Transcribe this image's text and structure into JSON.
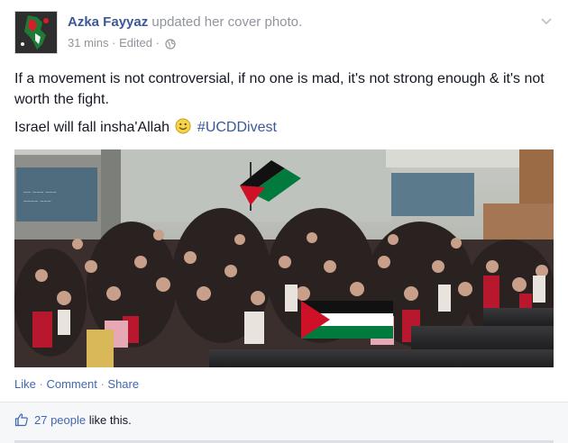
{
  "post": {
    "author": "Azka Fayyaz",
    "action": "updated her cover photo.",
    "time": "31 mins",
    "edited": "Edited",
    "paragraph1": "If a movement is not controversial, if no one is mad, it's not strong enough & it's not worth the fight.",
    "paragraph2_text": "Israel will fall insha'Allah",
    "hashtag": "#UCDDivest"
  },
  "actions": {
    "like": "Like",
    "comment": "Comment",
    "share": "Share",
    "separator": "·"
  },
  "likes": {
    "count_text": "27 people",
    "suffix": "like this."
  },
  "icons": {
    "chevron": "chevron-down-icon",
    "globe": "globe-icon",
    "smiley": "smiley-icon",
    "thumbs_up": "thumbs-up-icon"
  },
  "colors": {
    "link_blue": "#3b5998",
    "action_blue": "#4267b2",
    "meta_gray": "#90949c",
    "flag_red": "#ce1126",
    "flag_green": "#007a3d"
  }
}
